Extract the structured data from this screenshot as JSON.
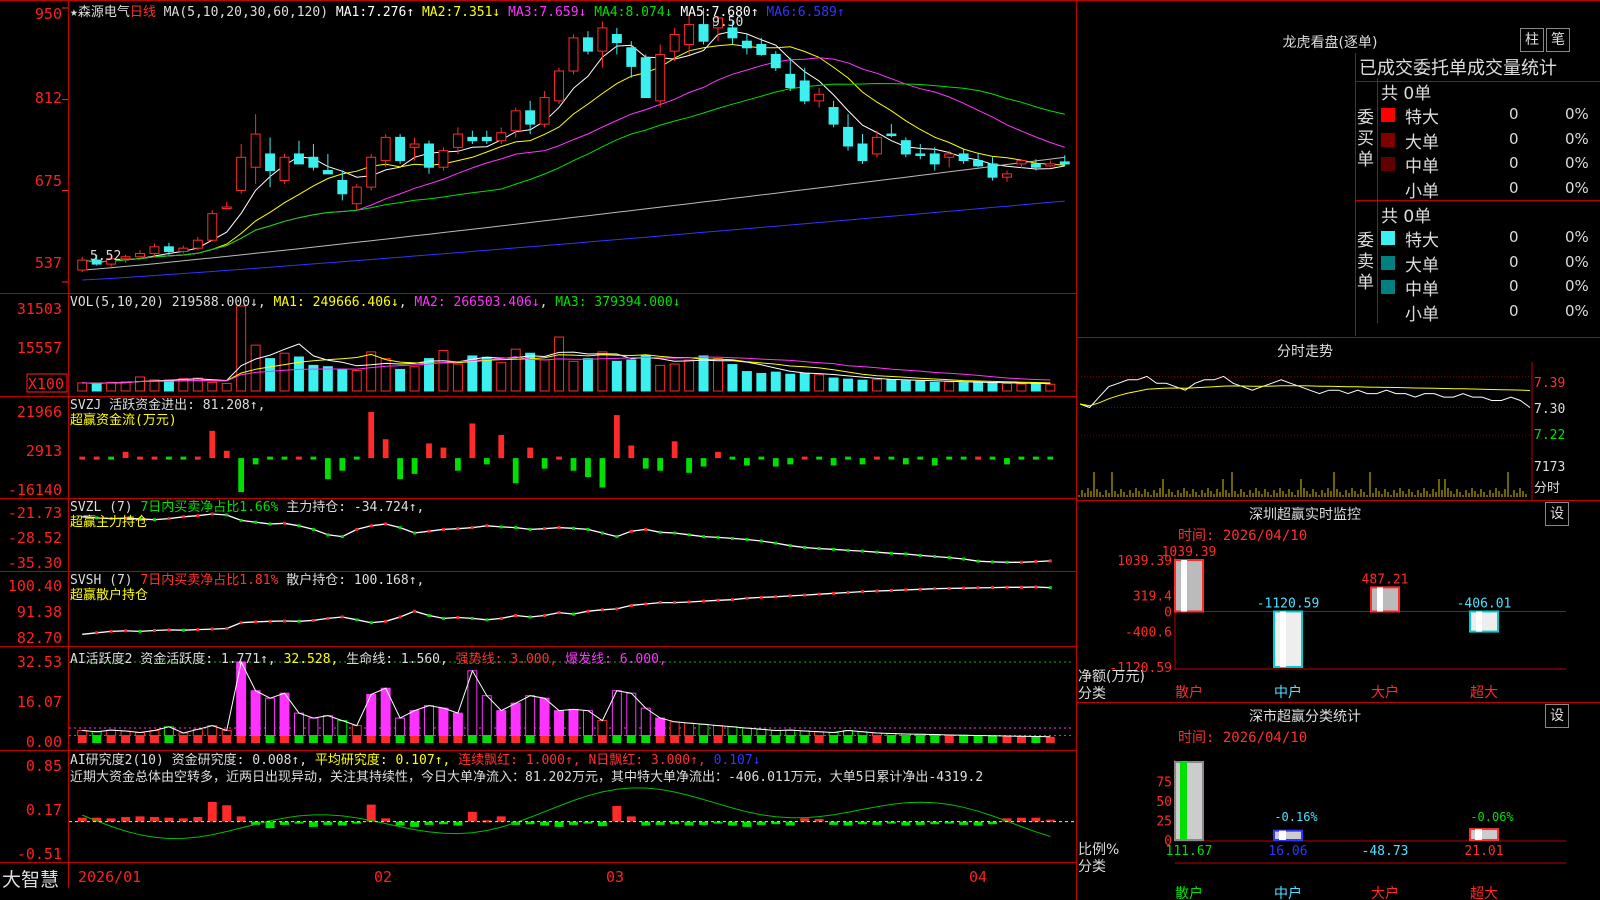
{
  "stock": {
    "name": "★森源电气",
    "period": "日线",
    "ma_params": "MA(5,10,20,30,60,120)",
    "ma_values": [
      {
        "label": "MA1:",
        "value": "7.276↑",
        "color": "#ffffff"
      },
      {
        "label": "MA2:",
        "value": "7.351↓",
        "color": "#ffff00"
      },
      {
        "label": "MA3:",
        "value": "7.659↓",
        "color": "#ff33ff"
      },
      {
        "label": "MA4:",
        "value": "8.074↓",
        "color": "#00e000"
      },
      {
        "label": "MA5:",
        "value": "7.680↑",
        "color": "#ffffff"
      },
      {
        "label": "MA6:",
        "value": "6.589↑",
        "color": "#3333ff"
      }
    ],
    "price_high_label": "9.50",
    "price_low_label": "5.52"
  },
  "panels": {
    "price": {
      "ticks": [
        "950",
        "812",
        "675",
        "537"
      ]
    },
    "vol": {
      "header": "VOL(5,10,20)",
      "value": "219588.000↓",
      "ma1": "MA1: 249666.406↓",
      "ma2": "MA2: 266503.406↓",
      "ma3": "MA3: 379394.000↓",
      "ticks": [
        "31503",
        "15557"
      ],
      "unit": "X100"
    },
    "svzj": {
      "header": "SVZJ  活跃资金进出: 81.208↑,",
      "sub": "超赢资金流(万元)",
      "ticks": [
        "21966",
        "2913",
        "-16140"
      ]
    },
    "svzl": {
      "header": "SVZL (7) ",
      "h2": "7日内买卖净占比1.66%",
      "h3": " 主力持仓: -34.724↑,",
      "sub": "超赢主力持仓",
      "ticks": [
        "-21.73",
        "-28.52",
        "-35.30"
      ]
    },
    "svsh": {
      "header": "SVSH (7) ",
      "h2": "7日内买卖净占比1.81%",
      "h3": " 散户持仓: 100.168↑,",
      "sub": "超赢散户持仓",
      "ticks": [
        "100.40",
        "91.38",
        "82.70"
      ]
    },
    "ai1": {
      "header": "AI活跃度2 资金活跃度: 1.771↑,",
      "v2": "32.528,",
      "v3": "生命线: 1.560,",
      "v4": "强势线: 3.000,",
      "v5": "爆发线: 6.000,",
      "ticks": [
        "32.53",
        "16.07",
        "0.00"
      ]
    },
    "ai2": {
      "header": "AI研究度2(10) 资金研究度: 0.008↑,",
      "v2": "平均研究度: 0.107↑,",
      "v3": "连续飘红: 1.000↑,",
      "v4": "N日飘红: 3.000↑,",
      "v5": "0.107↓",
      "ticks": [
        "0.85",
        "0.17",
        "-0.51"
      ],
      "commentary": "近期大资金总体由空转多，近两日出现异动，关注其持续性，今日大单净流入：81.202万元，其中特大单净流出：-406.011万元，大单5日累计净出-4319.2"
    }
  },
  "xaxis": {
    "labels": [
      "2026/01",
      "02",
      "03",
      "04"
    ]
  },
  "footer": {
    "brand": "大智慧"
  },
  "side": {
    "longhu": {
      "title": "龙虎看盘(逐单)",
      "btn1": "柱",
      "btn2": "笔",
      "heading": "已成交委托单成交量统计",
      "buy_label": "委买单",
      "sell_label": "委卖单",
      "buy_total": "共 0单",
      "sell_total": "共 0单",
      "buy_rows": [
        {
          "name": "特大",
          "v": "0",
          "p": "0%"
        },
        {
          "name": "大单",
          "v": "0",
          "p": "0%"
        },
        {
          "name": "中单",
          "v": "0",
          "p": "0%"
        },
        {
          "name": "小单",
          "v": "0",
          "p": "0%"
        }
      ],
      "sell_rows": [
        {
          "name": "特大",
          "v": "0",
          "p": "0%"
        },
        {
          "name": "大单",
          "v": "0",
          "p": "0%"
        },
        {
          "name": "中单",
          "v": "0",
          "p": "0%"
        },
        {
          "name": "小单",
          "v": "0",
          "p": "0%"
        }
      ]
    },
    "intraday": {
      "title": "分时走势",
      "ticks": [
        "7.39",
        "7.30",
        "7.22"
      ],
      "vol_tick": "7173",
      "vol_label": "分时"
    },
    "monitor": {
      "title": "深圳超赢实时监控",
      "btn": "设",
      "time": "时间: 2026/04/10",
      "ticks": [
        "1039.39",
        "319.4",
        "0",
        "-400.6",
        "-1120.59"
      ],
      "ylabel": "净额(万元)",
      "xlabel": "分类",
      "categories": [
        "散户",
        "中户",
        "大户",
        "超大"
      ],
      "values": [
        1039.39,
        -1120.59,
        487.21,
        -406.01
      ],
      "value_labels": [
        "1039.39",
        "-1120.59",
        "487.21",
        "-406.01"
      ]
    },
    "classify": {
      "title": "深市超赢分类统计",
      "btn": "设",
      "time": "时间: 2026/04/10",
      "ticks": [
        "75",
        "50",
        "25",
        "0"
      ],
      "ylabel": "比例%",
      "xlabel": "分类",
      "categories": [
        "散户",
        "中户",
        "大户",
        "超大"
      ],
      "values": [
        111.67,
        16.06,
        -48.73,
        21.01
      ],
      "value_labels": [
        "111.67",
        "16.06",
        "-48.73",
        "21.01"
      ],
      "pct_labels": [
        "",
        "-0.16%",
        "",
        "-0.06%"
      ]
    }
  },
  "chart_data": {
    "type": "candlestick",
    "price_ylim": [
      5.37,
      9.5
    ],
    "candles": [
      {
        "d": "01-05",
        "o": 5.55,
        "h": 5.75,
        "l": 5.52,
        "c": 5.7
      },
      {
        "d": "01-06",
        "o": 5.7,
        "h": 5.78,
        "l": 5.62,
        "c": 5.64
      },
      {
        "d": "01-07",
        "o": 5.64,
        "h": 5.76,
        "l": 5.6,
        "c": 5.72
      },
      {
        "d": "01-08",
        "o": 5.72,
        "h": 5.78,
        "l": 5.66,
        "c": 5.75
      },
      {
        "d": "01-09",
        "o": 5.75,
        "h": 5.85,
        "l": 5.7,
        "c": 5.8
      },
      {
        "d": "01-12",
        "o": 5.8,
        "h": 5.95,
        "l": 5.75,
        "c": 5.9
      },
      {
        "d": "01-13",
        "o": 5.9,
        "h": 5.96,
        "l": 5.78,
        "c": 5.83
      },
      {
        "d": "01-14",
        "o": 5.83,
        "h": 5.92,
        "l": 5.8,
        "c": 5.88
      },
      {
        "d": "01-15",
        "o": 5.88,
        "h": 6.05,
        "l": 5.85,
        "c": 6.0
      },
      {
        "d": "01-16",
        "o": 6.0,
        "h": 6.45,
        "l": 5.98,
        "c": 6.4
      },
      {
        "d": "01-19",
        "o": 6.48,
        "h": 6.58,
        "l": 6.46,
        "c": 6.5
      },
      {
        "d": "01-20",
        "o": 6.75,
        "h": 7.45,
        "l": 6.7,
        "c": 7.25
      },
      {
        "d": "01-21",
        "o": 7.1,
        "h": 7.9,
        "l": 6.85,
        "c": 7.6
      },
      {
        "d": "01-22",
        "o": 7.3,
        "h": 7.55,
        "l": 6.8,
        "c": 7.05
      },
      {
        "d": "01-23",
        "o": 6.9,
        "h": 7.3,
        "l": 6.85,
        "c": 7.25
      },
      {
        "d": "01-26",
        "o": 7.3,
        "h": 7.5,
        "l": 7.15,
        "c": 7.15
      },
      {
        "d": "01-27",
        "o": 7.25,
        "h": 7.45,
        "l": 7.05,
        "c": 7.1
      },
      {
        "d": "01-28",
        "o": 7.05,
        "h": 7.3,
        "l": 7.0,
        "c": 7.0
      },
      {
        "d": "01-29",
        "o": 6.9,
        "h": 7.05,
        "l": 6.6,
        "c": 6.7
      },
      {
        "d": "01-30",
        "o": 6.55,
        "h": 6.85,
        "l": 6.45,
        "c": 6.8
      },
      {
        "d": "02-02",
        "o": 6.8,
        "h": 7.3,
        "l": 6.75,
        "c": 7.25
      },
      {
        "d": "02-03",
        "o": 7.2,
        "h": 7.6,
        "l": 7.1,
        "c": 7.55
      },
      {
        "d": "02-04",
        "o": 7.55,
        "h": 7.6,
        "l": 7.15,
        "c": 7.2
      },
      {
        "d": "02-05",
        "o": 7.4,
        "h": 7.55,
        "l": 7.2,
        "c": 7.45
      },
      {
        "d": "02-06",
        "o": 7.45,
        "h": 7.5,
        "l": 7.0,
        "c": 7.1
      },
      {
        "d": "02-09",
        "o": 7.1,
        "h": 7.4,
        "l": 7.05,
        "c": 7.35
      },
      {
        "d": "02-10",
        "o": 7.4,
        "h": 7.7,
        "l": 7.3,
        "c": 7.6
      },
      {
        "d": "02-11",
        "o": 7.55,
        "h": 7.65,
        "l": 7.45,
        "c": 7.5
      },
      {
        "d": "02-12",
        "o": 7.55,
        "h": 7.65,
        "l": 7.45,
        "c": 7.5
      },
      {
        "d": "02-13",
        "o": 7.5,
        "h": 7.7,
        "l": 7.45,
        "c": 7.62
      },
      {
        "d": "02-16",
        "o": 7.65,
        "h": 8.0,
        "l": 7.55,
        "c": 7.95
      },
      {
        "d": "02-17",
        "o": 7.95,
        "h": 8.1,
        "l": 7.6,
        "c": 7.75
      },
      {
        "d": "02-18",
        "o": 7.75,
        "h": 8.25,
        "l": 7.7,
        "c": 8.15
      },
      {
        "d": "02-19",
        "o": 8.1,
        "h": 8.6,
        "l": 8.05,
        "c": 8.55
      },
      {
        "d": "02-20",
        "o": 8.55,
        "h": 9.1,
        "l": 8.5,
        "c": 9.05
      },
      {
        "d": "02-23",
        "o": 9.05,
        "h": 9.15,
        "l": 8.8,
        "c": 8.85
      },
      {
        "d": "02-24",
        "o": 8.85,
        "h": 9.3,
        "l": 8.6,
        "c": 9.2
      },
      {
        "d": "02-25",
        "o": 9.1,
        "h": 9.2,
        "l": 8.8,
        "c": 8.98
      },
      {
        "d": "02-26",
        "o": 8.9,
        "h": 9.0,
        "l": 8.45,
        "c": 8.62
      },
      {
        "d": "02-27",
        "o": 8.75,
        "h": 8.8,
        "l": 8.4,
        "c": 8.15
      },
      {
        "d": "03-02",
        "o": 8.1,
        "h": 8.95,
        "l": 8.0,
        "c": 8.8
      },
      {
        "d": "03-03",
        "o": 8.85,
        "h": 9.2,
        "l": 8.7,
        "c": 9.1
      },
      {
        "d": "03-04",
        "o": 8.95,
        "h": 9.4,
        "l": 8.8,
        "c": 9.25
      },
      {
        "d": "03-05",
        "o": 9.25,
        "h": 9.5,
        "l": 8.95,
        "c": 9.0
      },
      {
        "d": "03-06",
        "o": 9.2,
        "h": 9.38,
        "l": 9.0,
        "c": 9.35
      },
      {
        "d": "03-09",
        "o": 9.2,
        "h": 9.3,
        "l": 8.95,
        "c": 9.05
      },
      {
        "d": "03-10",
        "o": 9.0,
        "h": 9.1,
        "l": 8.8,
        "c": 8.9
      },
      {
        "d": "03-11",
        "o": 8.95,
        "h": 9.05,
        "l": 8.78,
        "c": 8.8
      },
      {
        "d": "03-12",
        "o": 8.8,
        "h": 8.85,
        "l": 8.55,
        "c": 8.6
      },
      {
        "d": "03-13",
        "o": 8.5,
        "h": 8.75,
        "l": 8.25,
        "c": 8.3
      },
      {
        "d": "03-16",
        "o": 8.4,
        "h": 8.6,
        "l": 8.05,
        "c": 8.1
      },
      {
        "d": "03-17",
        "o": 8.1,
        "h": 8.3,
        "l": 8.0,
        "c": 8.2
      },
      {
        "d": "03-18",
        "o": 8.0,
        "h": 8.1,
        "l": 7.7,
        "c": 7.75
      },
      {
        "d": "03-19",
        "o": 7.7,
        "h": 7.9,
        "l": 7.35,
        "c": 7.42
      },
      {
        "d": "03-20",
        "o": 7.45,
        "h": 7.6,
        "l": 7.15,
        "c": 7.2
      },
      {
        "d": "03-23",
        "o": 7.3,
        "h": 7.65,
        "l": 7.25,
        "c": 7.55
      },
      {
        "d": "03-24",
        "o": 7.6,
        "h": 7.75,
        "l": 7.55,
        "c": 7.58
      },
      {
        "d": "03-25",
        "o": 7.5,
        "h": 7.55,
        "l": 7.25,
        "c": 7.3
      },
      {
        "d": "03-26",
        "o": 7.3,
        "h": 7.45,
        "l": 7.22,
        "c": 7.28
      },
      {
        "d": "03-27",
        "o": 7.3,
        "h": 7.4,
        "l": 7.05,
        "c": 7.15
      },
      {
        "d": "03-30",
        "o": 7.25,
        "h": 7.35,
        "l": 7.1,
        "c": 7.3
      },
      {
        "d": "03-31",
        "o": 7.3,
        "h": 7.38,
        "l": 7.15,
        "c": 7.2
      },
      {
        "d": "04-01",
        "o": 7.2,
        "h": 7.32,
        "l": 7.1,
        "c": 7.12
      },
      {
        "d": "04-02",
        "o": 7.15,
        "h": 7.25,
        "l": 6.9,
        "c": 6.95
      },
      {
        "d": "04-03",
        "o": 6.95,
        "h": 7.05,
        "l": 6.88,
        "c": 7.0
      },
      {
        "d": "04-07",
        "o": 7.15,
        "h": 7.22,
        "l": 7.08,
        "c": 7.2
      },
      {
        "d": "04-08",
        "o": 7.15,
        "h": 7.22,
        "l": 7.05,
        "c": 7.1
      },
      {
        "d": "04-09",
        "o": 7.12,
        "h": 7.2,
        "l": 7.1,
        "c": 7.15
      },
      {
        "d": "04-10",
        "o": 7.18,
        "h": 7.28,
        "l": 7.12,
        "c": 7.15
      }
    ],
    "volume_ylim": [
      0,
      31503
    ],
    "volume": [
      3000,
      2800,
      3200,
      3400,
      5200,
      4100,
      4000,
      4600,
      4800,
      3200,
      2800,
      31503,
      17000,
      12000,
      14000,
      12600,
      9500,
      9000,
      8000,
      7600,
      14500,
      12000,
      8000,
      9000,
      12000,
      15000,
      10000,
      13000,
      12500,
      10500,
      15500,
      14000,
      11500,
      20000,
      11000,
      12000,
      14500,
      11000,
      11500,
      13200,
      9500,
      10000,
      11500,
      13000,
      12000,
      9800,
      7200,
      6500,
      7000,
      6200,
      6500,
      6000,
      4800,
      4400,
      4000,
      4200,
      4100,
      3800,
      3600,
      3200,
      3400,
      3100,
      3200,
      2900,
      2800,
      2600,
      2900,
      2500
    ],
    "svzj": [
      2500,
      1000,
      -1500,
      3000,
      2000,
      1000,
      -1000,
      -1500,
      1500,
      13000,
      3500,
      -16140,
      -3000,
      -2000,
      -500,
      1200,
      -2000,
      -10000,
      -6000,
      -1000,
      21966,
      9000,
      -10000,
      -7500,
      7000,
      5000,
      -6000,
      16500,
      -3000,
      11000,
      -12000,
      5000,
      -5000,
      2800,
      -6000,
      -9000,
      -14000,
      20500,
      6000,
      -5000,
      -6000,
      8000,
      -7000,
      -4000,
      3000,
      -2500,
      -3500,
      -2000,
      -4000,
      -3000,
      2000,
      -2500,
      -3500,
      -1500,
      -3000,
      1500,
      -2000,
      -3000,
      -1500,
      -3500,
      -2500,
      -1800,
      2000,
      -1500,
      -3000,
      -2500,
      -2800,
      -2000
    ],
    "svzl": [
      -22.5,
      -22.8,
      -23.0,
      -22.9,
      -23.1,
      -23.3,
      -23.0,
      -22.5,
      -22.2,
      -21.73,
      -22.0,
      -23.5,
      -24.0,
      -24.5,
      -24.3,
      -25.0,
      -26.0,
      -27.5,
      -28.0,
      -26.0,
      -25.0,
      -24.5,
      -25.5,
      -27.0,
      -26.5,
      -26.0,
      -25.8,
      -25.5,
      -25.0,
      -25.3,
      -25.5,
      -26.0,
      -25.8,
      -25.5,
      -25.7,
      -26.0,
      -27.0,
      -28.0,
      -26.5,
      -26.0,
      -26.8,
      -27.0,
      -27.5,
      -28.0,
      -28.2,
      -28.5,
      -28.8,
      -29.2,
      -29.8,
      -30.5,
      -31.0,
      -31.3,
      -31.5,
      -31.8,
      -32.0,
      -32.3,
      -32.6,
      -32.8,
      -33.2,
      -33.5,
      -33.8,
      -34.2,
      -34.8,
      -35.0,
      -35.1,
      -35.1,
      -34.9,
      -34.72
    ],
    "svsh": [
      84.0,
      84.5,
      85.0,
      85.2,
      85.0,
      85.3,
      85.5,
      85.4,
      85.6,
      85.8,
      86.0,
      88.0,
      88.3,
      88.5,
      88.6,
      88.5,
      88.8,
      89.5,
      90.0,
      89.0,
      88.0,
      88.5,
      90.0,
      92.0,
      90.5,
      89.5,
      89.8,
      89.5,
      89.0,
      89.5,
      90.5,
      90.0,
      90.5,
      91.5,
      91.0,
      92.0,
      92.5,
      92.8,
      94.0,
      94.5,
      95.0,
      95.0,
      95.2,
      95.5,
      95.8,
      96.0,
      96.5,
      96.8,
      97.0,
      97.3,
      97.6,
      97.9,
      98.2,
      98.5,
      98.8,
      99.0,
      99.2,
      99.4,
      99.6,
      99.8,
      99.9,
      100.0,
      100.1,
      100.2,
      100.3,
      100.3,
      100.4,
      100.17
    ],
    "ai1": [
      5.0,
      4.5,
      5.2,
      4.8,
      4.2,
      5.0,
      6.5,
      4.0,
      5.5,
      7.0,
      5.0,
      32.53,
      21.0,
      18.0,
      20.0,
      12.0,
      10.0,
      11.0,
      9.0,
      7.0,
      19.5,
      22.0,
      10.0,
      13.0,
      15.0,
      14.0,
      12.0,
      29.0,
      19.0,
      13.0,
      16.0,
      19.0,
      18.0,
      13.0,
      13.5,
      13.0,
      9.0,
      21.0,
      20.0,
      14.0,
      10.0,
      8.5,
      8.0,
      7.5,
      7.0,
      6.5,
      6.0,
      5.5,
      5.0,
      5.2,
      4.8,
      4.5,
      4.2,
      5.0,
      4.5,
      4.0,
      3.8,
      3.6,
      3.5,
      3.4,
      3.2,
      3.1,
      3.0,
      2.9,
      2.8,
      2.7,
      2.6,
      2.5
    ],
    "ai2": [
      0.06,
      0.06,
      0.05,
      0.07,
      0.08,
      0.07,
      0.06,
      0.05,
      0.07,
      0.3,
      0.25,
      0.08,
      -0.05,
      -0.1,
      -0.05,
      -0.03,
      -0.08,
      -0.05,
      -0.06,
      -0.02,
      0.26,
      0.05,
      -0.06,
      -0.08,
      -0.05,
      -0.04,
      -0.06,
      0.15,
      0.02,
      0.08,
      -0.05,
      -0.04,
      -0.06,
      -0.08,
      -0.05,
      -0.03,
      -0.07,
      0.24,
      0.08,
      -0.06,
      -0.05,
      -0.04,
      -0.06,
      -0.05,
      -0.03,
      -0.06,
      -0.08,
      -0.05,
      -0.04,
      -0.06,
      0.05,
      0.04,
      -0.05,
      -0.06,
      -0.04,
      -0.05,
      -0.03,
      -0.06,
      -0.05,
      -0.04,
      -0.03,
      -0.05,
      -0.06,
      -0.04,
      0.05,
      0.06,
      0.06,
      0.03
    ],
    "intraday": [
      7.31,
      7.3,
      7.33,
      7.36,
      7.37,
      7.38,
      7.38,
      7.39,
      7.37,
      7.37,
      7.36,
      7.35,
      7.37,
      7.38,
      7.38,
      7.39,
      7.37,
      7.36,
      7.35,
      7.36,
      7.37,
      7.38,
      7.37,
      7.36,
      7.35,
      7.34,
      7.35,
      7.35,
      7.34,
      7.35,
      7.34,
      7.34,
      7.35,
      7.34,
      7.34,
      7.33,
      7.34,
      7.34,
      7.33,
      7.33,
      7.34,
      7.33,
      7.33,
      7.32,
      7.32,
      7.33,
      7.32,
      7.3
    ]
  }
}
